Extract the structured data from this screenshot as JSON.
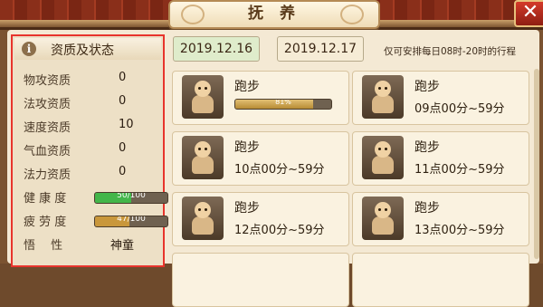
{
  "window": {
    "title": "抚 养",
    "close": "✕"
  },
  "stats": {
    "title": "资质及状态",
    "info_icon": "i",
    "rows": [
      {
        "label": "物攻资质",
        "value": "0"
      },
      {
        "label": "法攻资质",
        "value": "0"
      },
      {
        "label": "速度资质",
        "value": "10"
      },
      {
        "label": "气血资质",
        "value": "0"
      },
      {
        "label": "法力资质",
        "value": "0"
      }
    ],
    "health": {
      "label": "健 康 度",
      "text": "50/100",
      "fraction": 0.5,
      "color": "#43b64a"
    },
    "fatigue": {
      "label": "疲 劳 度",
      "text": "47/100",
      "fraction": 0.47,
      "color": "#c9973b"
    },
    "nature": {
      "label": "悟　 性",
      "value": "神童"
    }
  },
  "dates": [
    {
      "label": "2019.12.16",
      "selected": true
    },
    {
      "label": "2019.12.17",
      "selected": false
    }
  ],
  "tip": "仅可安排每日08时-20时的行程",
  "cards": [
    {
      "title": "跑步",
      "progress_text": "81%",
      "progress": 0.81
    },
    {
      "title": "跑步",
      "time": "09点00分~59分"
    },
    {
      "title": "跑步",
      "time": "10点00分~59分"
    },
    {
      "title": "跑步",
      "time": "11点00分~59分"
    },
    {
      "title": "跑步",
      "time": "12点00分~59分"
    },
    {
      "title": "跑步",
      "time": "13点00分~59分"
    }
  ]
}
